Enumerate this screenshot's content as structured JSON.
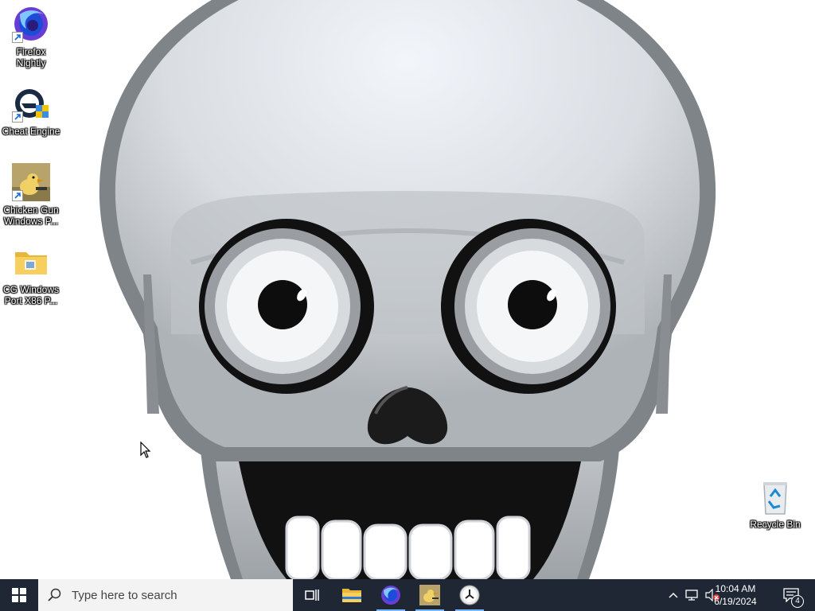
{
  "desktop": {
    "icons": [
      {
        "label": "Firefox Nightly",
        "icon": "firefox-nightly-icon"
      },
      {
        "label": "Cheat Engine",
        "icon": "cheat-engine-icon"
      },
      {
        "label": "Chicken Gun Windows P...",
        "icon": "chicken-gun-icon"
      },
      {
        "label": "CG Windows Port X86 P...",
        "icon": "folder-icon"
      },
      {
        "label": "Recycle Bin",
        "icon": "recycle-bin-icon"
      }
    ]
  },
  "taskbar": {
    "search_placeholder": "Type here to search",
    "apps": [
      {
        "name": "task-view",
        "icon": "task-view-icon"
      },
      {
        "name": "file-explorer",
        "icon": "folder-icon"
      },
      {
        "name": "firefox",
        "icon": "firefox-icon"
      },
      {
        "name": "chicken-gun",
        "icon": "chicken-gun-icon"
      },
      {
        "name": "clock-app",
        "icon": "clock-icon"
      }
    ],
    "tray": {
      "time": "10:04 AM",
      "date": "6/19/2024",
      "notification_count": "4"
    }
  },
  "colors": {
    "taskbar_bg": "#1f2735",
    "accent": "#78b6ff"
  }
}
